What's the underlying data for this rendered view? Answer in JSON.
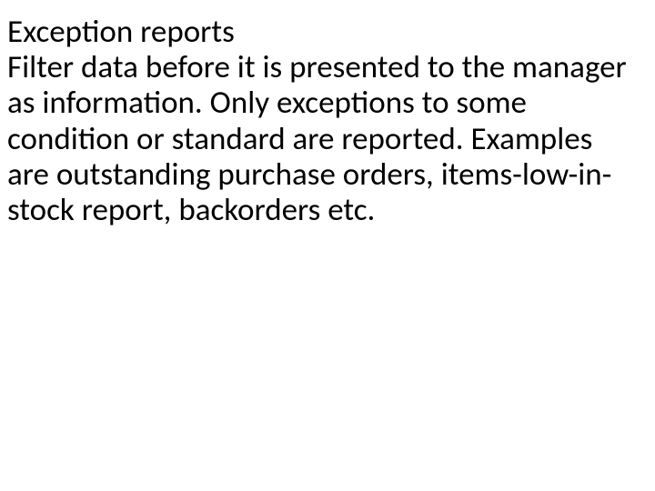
{
  "slide": {
    "heading": "Exception reports",
    "body": "Filter data before it is presented to the manager as information. Only exceptions to some condition or standard are reported. Examples are outstanding purchase orders, items-low-in-stock report, backorders etc."
  }
}
